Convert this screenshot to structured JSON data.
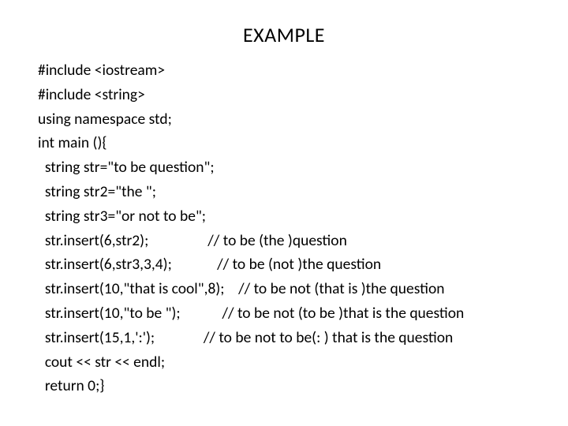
{
  "title": "EXAMPLE",
  "lines": [
    "#include <iostream>",
    "#include <string>",
    "using namespace std;",
    "int main (){",
    "  string str=\"to be question\";",
    "  string str2=\"the \";",
    "  string str3=\"or not to be\";",
    "  str.insert(6,str2);                 // to be (the )question",
    "  str.insert(6,str3,3,4);             // to be (not )the question",
    "  str.insert(10,\"that is cool\",8);    // to be not (that is )the question",
    "  str.insert(10,\"to be \");            // to be not (to be )that is the question",
    "  str.insert(15,1,':');              // to be not to be(: ) that is the question",
    "  cout << str << endl;",
    "  return 0;}"
  ]
}
